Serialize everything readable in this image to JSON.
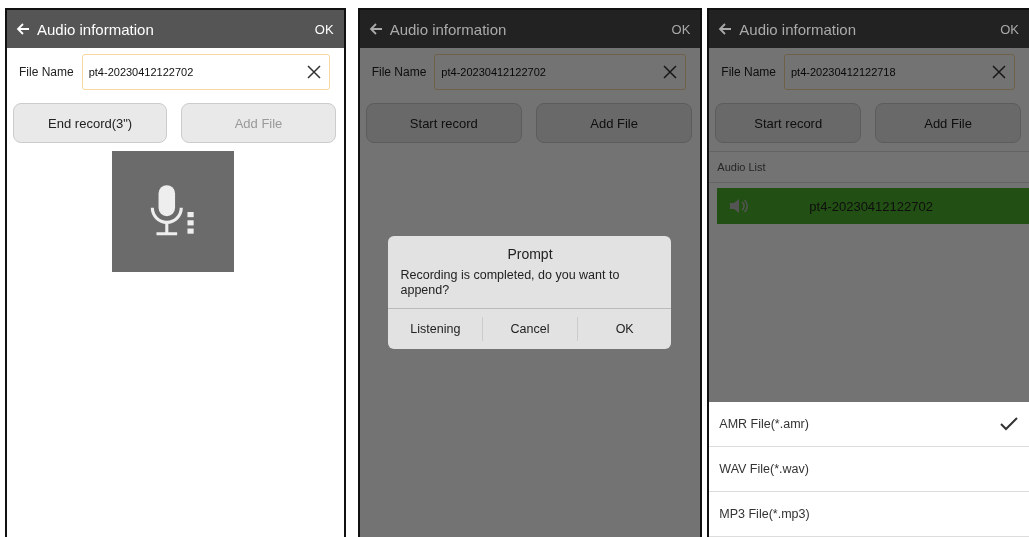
{
  "panels": [
    {
      "header": {
        "title": "Audio information",
        "action": "OK"
      },
      "file_name": {
        "label": "File Name",
        "value": "pt4-20230412122702"
      },
      "buttons": [
        {
          "label": "End record(3\")",
          "disabled": false
        },
        {
          "label": "Add File",
          "disabled": true
        }
      ],
      "recording": true,
      "dimmed": false
    },
    {
      "header": {
        "title": "Audio information",
        "action": "OK"
      },
      "file_name": {
        "label": "File Name",
        "value": "pt4-20230412122702"
      },
      "buttons": [
        {
          "label": "Start record",
          "disabled": false
        },
        {
          "label": "Add File",
          "disabled": false
        }
      ],
      "recording": false,
      "dimmed": true,
      "dialog": {
        "title": "Prompt",
        "message": "Recording is completed, do you want to append?",
        "actions": [
          "Listening",
          "Cancel",
          "OK"
        ]
      }
    },
    {
      "header": {
        "title": "Audio information",
        "action": "OK"
      },
      "file_name": {
        "label": "File Name",
        "value": "pt4-20230412122718"
      },
      "buttons": [
        {
          "label": "Start record",
          "disabled": false
        },
        {
          "label": "Add File",
          "disabled": false
        }
      ],
      "recording": false,
      "dimmed": true,
      "audio_list": {
        "heading": "Audio List",
        "items": [
          {
            "name": "pt4-20230412122702",
            "selected": true
          }
        ]
      },
      "format_sheet": [
        {
          "label": "AMR File(*.amr)",
          "selected": true
        },
        {
          "label": "WAV File(*.wav)",
          "selected": false
        },
        {
          "label": "MP3 File(*.mp3)",
          "selected": false
        }
      ]
    }
  ]
}
